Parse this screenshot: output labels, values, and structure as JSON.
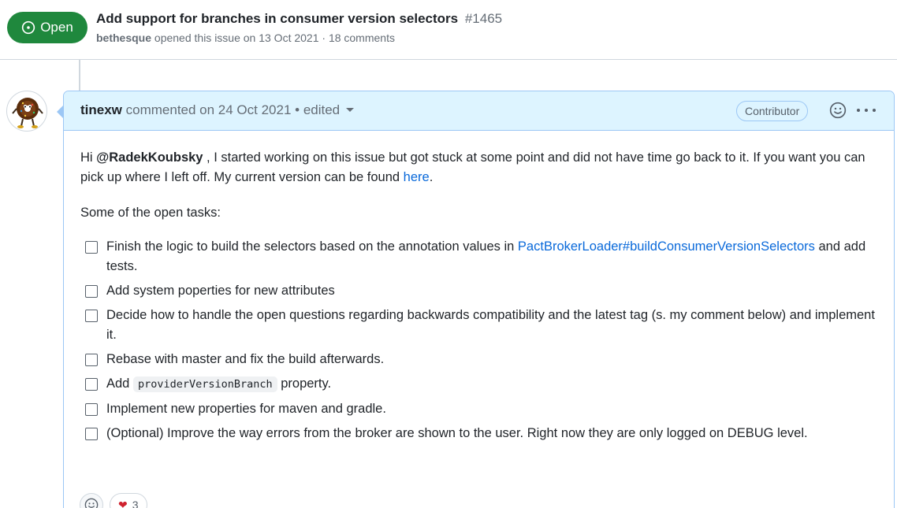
{
  "issue": {
    "state_label": "Open",
    "title": "Add support for branches in consumer version selectors",
    "number": "#1465",
    "author": "bethesque",
    "meta_text": " opened this issue on 13 Oct 2021 · 18 comments"
  },
  "comment": {
    "author": "tinexw",
    "header_text": " commented on 24 Oct 2021 • edited",
    "role": "Contributor",
    "intro_prefix": "Hi ",
    "mention": "@RadekKoubsky",
    "intro_text": " , I started working on this issue but got stuck at some point and did not have time go back to it. If you want you can pick up where I left off. My current version can be found ",
    "intro_link": "here",
    "intro_suffix": ".",
    "tasks_heading": "Some of the open tasks:",
    "tasks": [
      {
        "prefix": "Finish the logic to build the selectors based on the annotation values in ",
        "link": "PactBrokerLoader#buildConsumerVersionSelectors",
        "suffix": " and add tests."
      },
      {
        "text": "Add system poperties for new attributes"
      },
      {
        "text": "Decide how to handle the open questions regarding backwards compatibility and the latest tag (s. my comment below) and implement it."
      },
      {
        "text": "Rebase with master and fix the build afterwards."
      },
      {
        "prefix": "Add ",
        "code": "providerVersionBranch",
        "suffix": " property."
      },
      {
        "text": "Implement new properties for maven and gradle."
      },
      {
        "text": "(Optional) Improve the way errors from the broker are shown to the user. Right now they are only logged on DEBUG level."
      }
    ],
    "reactions": {
      "heart_count": "3"
    }
  },
  "icons": {
    "state": "issue-opened-icon",
    "reaction": "smiley-icon",
    "more": "kebab-horizontal-icon",
    "heart": "heart-icon"
  }
}
